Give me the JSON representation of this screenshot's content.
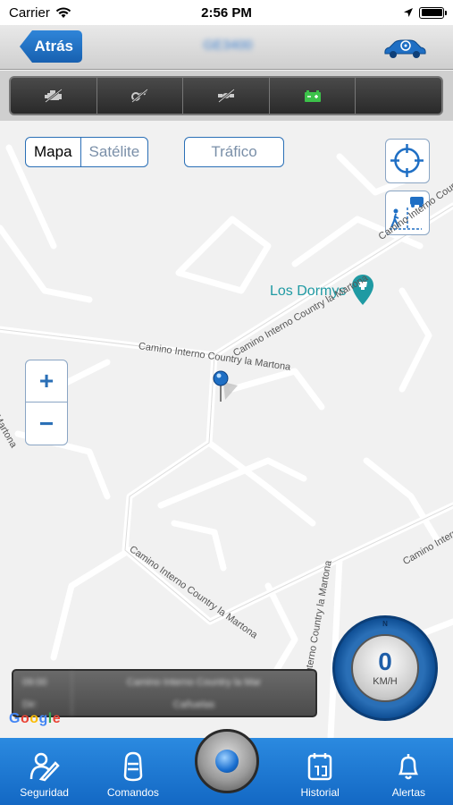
{
  "status_bar": {
    "carrier": "Carrier",
    "time": "2:56 PM"
  },
  "nav": {
    "back_label": "Atrás",
    "title": "GE3400"
  },
  "toolbar": {
    "icons": [
      "engine-off-icon",
      "key-off-icon",
      "satellite-off-icon",
      "battery-icon",
      "empty"
    ]
  },
  "map": {
    "segmented": {
      "map": "Mapa",
      "satellite": "Satélite"
    },
    "traffic": "Tráfico",
    "zoom_in": "+",
    "zoom_out": "−",
    "poi": "Los Dormys",
    "road_name": "Camino Interno Country la Martona",
    "google": "Google",
    "info_panel": {
      "row1_label": "09:00",
      "row2_label": "Dir:",
      "row1_value": "Camino Interno Country la Mar",
      "row2_value": "Cañuelas"
    }
  },
  "speedometer": {
    "value": "0",
    "unit": "KM/H",
    "north": "N"
  },
  "tabs": [
    {
      "label": "Seguridad",
      "icon": "security-icon"
    },
    {
      "label": "Comandos",
      "icon": "commands-icon"
    },
    {
      "label": "",
      "icon": "center-button"
    },
    {
      "label": "Historial",
      "icon": "history-icon"
    },
    {
      "label": "Alertas",
      "icon": "bell-icon"
    }
  ],
  "colors": {
    "accent": "#1f6fc4",
    "poi": "#1f9aa3"
  }
}
